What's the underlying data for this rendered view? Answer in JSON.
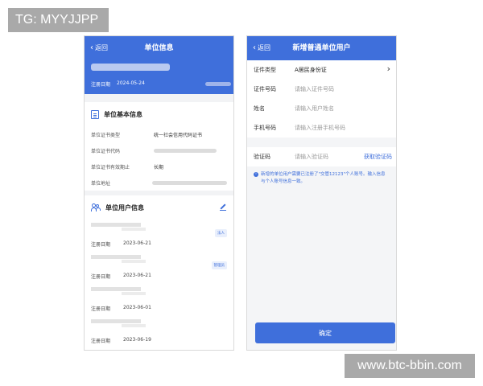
{
  "watermarks": {
    "top": "TG: MYYJJPP",
    "bottom": "www.btc-bbin.com"
  },
  "left_screen": {
    "nav": {
      "back_label": "返回",
      "title": "单位信息"
    },
    "header": {
      "reg_label": "注册日期",
      "reg_date": "2024-05-24"
    },
    "basic_info": {
      "title": "单位基本信息",
      "rows": [
        {
          "label": "单位证书类型",
          "value": "统一社会信用代码证书"
        },
        {
          "label": "单位证书代码",
          "value": ""
        },
        {
          "label": "单位证书有效期止",
          "value": "长期"
        },
        {
          "label": "单位地址",
          "value": ""
        }
      ]
    },
    "users": {
      "title": "单位用户信息",
      "items": [
        {
          "date_label": "注册日期",
          "date": "2023-06-21",
          "tag": "法人"
        },
        {
          "date_label": "注册日期",
          "date": "2023-06-21",
          "tag": "管理员"
        },
        {
          "date_label": "注册日期",
          "date": "2023-06-01",
          "tag": ""
        },
        {
          "date_label": "注册日期",
          "date": "2023-06-19",
          "tag": ""
        }
      ]
    }
  },
  "right_screen": {
    "nav": {
      "back_label": "返回",
      "title": "新增普通单位用户"
    },
    "form": {
      "cert_type": {
        "label": "证件类型",
        "value": "A居民身份证"
      },
      "cert_no": {
        "label": "证件号码",
        "placeholder": "请输入证件号码"
      },
      "name": {
        "label": "姓名",
        "placeholder": "请输入用户姓名"
      },
      "phone": {
        "label": "手机号码",
        "placeholder": "请输入注册手机号码"
      },
      "code": {
        "label": "验证码",
        "placeholder": "请输入验证码",
        "get_code": "获取验证码"
      }
    },
    "notice": "新增的单位用户需要已注册了\"交管12123\"个人账号。输入信息与个人账号信息一致。",
    "confirm_label": "确定"
  },
  "colors": {
    "primary": "#3f6fdb"
  }
}
